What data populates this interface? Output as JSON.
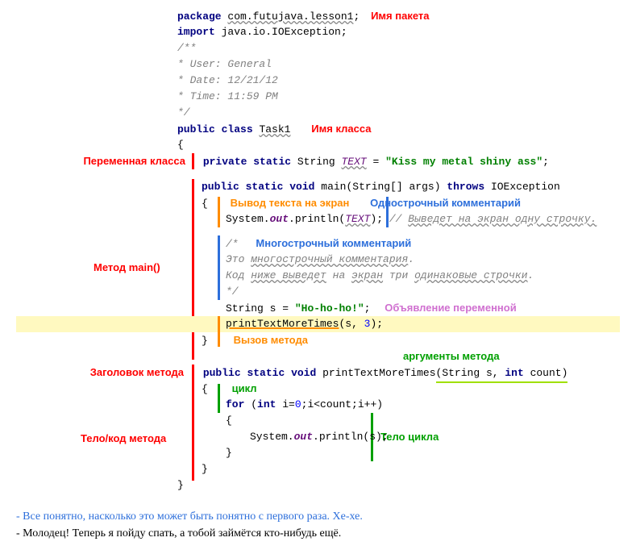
{
  "annotations": {
    "package_name": "Имя пакета",
    "class_name": "Имя класса",
    "class_variable": "Переменная класса",
    "main_method": "Метод main()",
    "print_screen": "Вывод текста на экран",
    "single_line_comment": "Однострочный комментарий",
    "multi_line_comment": "Многострочный комментарий",
    "var_declaration": "Объявление переменной",
    "method_call": "Вызов метода",
    "method_header": "Заголовок метода",
    "method_body": "Тело/код метода",
    "method_args": "аргументы метода",
    "loop": "цикл",
    "loop_body": "Тело цикла"
  },
  "code": {
    "package_kw": "package",
    "package_val": "com.futujava.lesson1",
    "semi": ";",
    "import_kw": "import",
    "import_val": "java.io.IOException",
    "doc_open": "/**",
    "doc_user": " * User: General",
    "doc_date": " * Date: 12/21/12",
    "doc_time": " * Time: 11:59 PM",
    "doc_close": " */",
    "public_kw": "public",
    "class_kw": "class",
    "class_name": "Task1",
    "lbrace": "{",
    "rbrace": "}",
    "private_kw": "private",
    "static_kw": "static",
    "string_type": "String",
    "text_field": "TEXT",
    "eq": " = ",
    "text_value": "\"Kiss my metal shiny ass\"",
    "void_kw": "void",
    "main_sig": "main(String[] args)",
    "throws_kw": "throws",
    "ioexception": "IOException",
    "sys": "System.",
    "out": "out",
    "println": ".println(",
    "close_paren_semi": ");",
    "inline_comment_text": "Выведет на экран одну строчку.",
    "inline_comment_prefix": "// ",
    "mc_open": "/*",
    "mc_line1_pre": "   Это ",
    "mc_line1_u": "многострочный комментария",
    "mc_line1_post": ".",
    "mc_line2_pre": "   Код ",
    "mc_line2_u1": "ниже выведет",
    "mc_line2_mid": " на ",
    "mc_line2_u2": "экран",
    "mc_line2_mid2": " три ",
    "mc_line2_u3": "одинаковые строчки",
    "mc_line2_post": ".",
    "mc_close": " */",
    "s_var": "s",
    "hohoho": "\"Ho-ho-ho!\"",
    "print_more": "printTextMoreTimes",
    "args_open": "(",
    "s_arg": "s",
    "comma_sp": ", ",
    "three": "3",
    "args_close": ");",
    "method2_sig_a": "printTextMoreTimes",
    "method2_sig_b": "(String s, ",
    "int_kw": "int",
    "count_param": " count)",
    "for_kw": "for",
    "for_open": " (",
    "for_int": "int",
    "for_i_init": " i=",
    "zero": "0",
    "for_cond": ";i<count;i++)"
  },
  "dialogue": {
    "line1": "- Все понятно, насколько это может быть понятно с первого раза. Хе-хе.",
    "line2": "- Молодец! Теперь я пойду спать, а тобой займётся кто-нибудь ещё."
  }
}
